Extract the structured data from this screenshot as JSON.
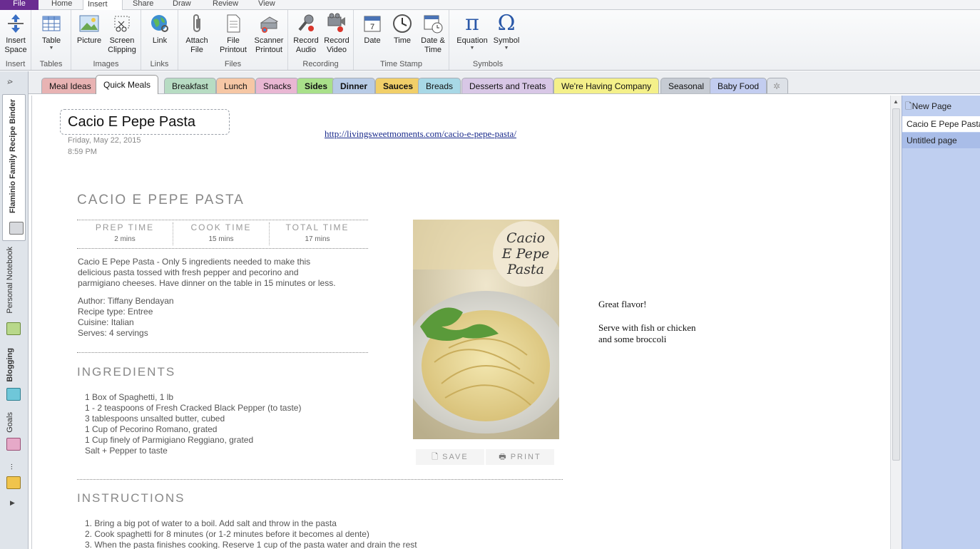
{
  "ribbon_tabs": [
    "File",
    "Home",
    "Insert",
    "Share",
    "Draw",
    "Review",
    "View"
  ],
  "ribbon_groups": [
    {
      "label": "Insert",
      "buttons": [
        "Insert Space"
      ]
    },
    {
      "label": "Tables",
      "buttons": [
        "Table"
      ]
    },
    {
      "label": "Images",
      "buttons": [
        "Picture",
        "Screen Clipping"
      ]
    },
    {
      "label": "Links",
      "buttons": [
        "Link"
      ]
    },
    {
      "label": "Files",
      "buttons": [
        "Attach File",
        "File Printout",
        "Scanner Printout"
      ]
    },
    {
      "label": "Recording",
      "buttons": [
        "Record Audio",
        "Record Video"
      ]
    },
    {
      "label": "Time Stamp",
      "buttons": [
        "Date",
        "Time",
        "Date & Time"
      ]
    },
    {
      "label": "Symbols",
      "buttons": [
        "Equation",
        "Symbol"
      ]
    }
  ],
  "notebooks": [
    "Flaminio Family Recipe Binder",
    "Personal Notebook",
    "Blogging",
    "Goals",
    "..."
  ],
  "sections": [
    {
      "label": "Meal Ideas",
      "color": "#e8b3b3"
    },
    {
      "label": "Quick Meals",
      "color": "#ffffff"
    },
    {
      "label": "Breakfast",
      "color": "#b7dcc3"
    },
    {
      "label": "Lunch",
      "color": "#f6c7a5"
    },
    {
      "label": "Snacks",
      "color": "#e9b7d3"
    },
    {
      "label": "Sides",
      "color": "#a9e08a"
    },
    {
      "label": "Dinner",
      "color": "#b8cbe6"
    },
    {
      "label": "Sauces",
      "color": "#f1cf69"
    },
    {
      "label": "Breads",
      "color": "#a8d8e6"
    },
    {
      "label": "Desserts and Treats",
      "color": "#d8c7e6"
    },
    {
      "label": "We're Having Company",
      "color": "#f4f08a"
    },
    {
      "label": "Seasonal",
      "color": "#c6cbd3"
    },
    {
      "label": "Baby Food",
      "color": "#c3cdf0"
    }
  ],
  "page": {
    "title": "Cacio E Pepe Pasta",
    "date": "Friday, May 22, 2015",
    "time": "8:59 PM",
    "url": "http://livingsweetmoments.com/cacio-e-pepe-pasta/"
  },
  "recipe": {
    "heading": "CACIO E PEPE PASTA",
    "times": [
      {
        "label": "PREP TIME",
        "value": "2 mins"
      },
      {
        "label": "COOK TIME",
        "value": "15 mins"
      },
      {
        "label": "TOTAL TIME",
        "value": "17 mins"
      }
    ],
    "description": [
      "Cacio E Pepe Pasta - Only 5 ingredients needed to make this",
      "delicious pasta tossed with fresh pepper and pecorino and",
      "parmigiano cheeses. Have dinner on the table in 15 minutes or less."
    ],
    "info": [
      "Author: Tiffany Bendayan",
      "Recipe type: Entree",
      "Cuisine: Italian",
      "Serves: 4 servings"
    ],
    "ingredients_heading": "INGREDIENTS",
    "ingredients": [
      "1 Box of Spaghetti, 1 lb",
      "1 - 2 teaspoons of Fresh Cracked Black Pepper (to taste)",
      "3 tablespoons unsalted butter, cubed",
      "1 Cup of Pecorino Romano, grated",
      "1 Cup finely of Parmigiano Reggiano, grated",
      "Salt + Pepper to taste"
    ],
    "instructions_heading": "INSTRUCTIONS",
    "instructions": [
      "1.  Bring a big pot of water to a boil. Add salt and throw in the pasta",
      "2.  Cook spaghetti for 8 minutes (or 1-2 minutes before it becomes al dente)",
      "3.  When the pasta finishes cooking. Reserve 1 cup of the pasta water and drain the rest"
    ],
    "photo_caption": [
      "Cacio",
      "E Pepe",
      "Pasta"
    ],
    "save": "SAVE",
    "print": "PRINT"
  },
  "notes": [
    "Great flavor!",
    "Serve with fish or chicken",
    "and some broccoli"
  ],
  "pages": {
    "new_page": "New Page",
    "items": [
      "Cacio E Pepe Pasta",
      "Untitled page"
    ]
  }
}
